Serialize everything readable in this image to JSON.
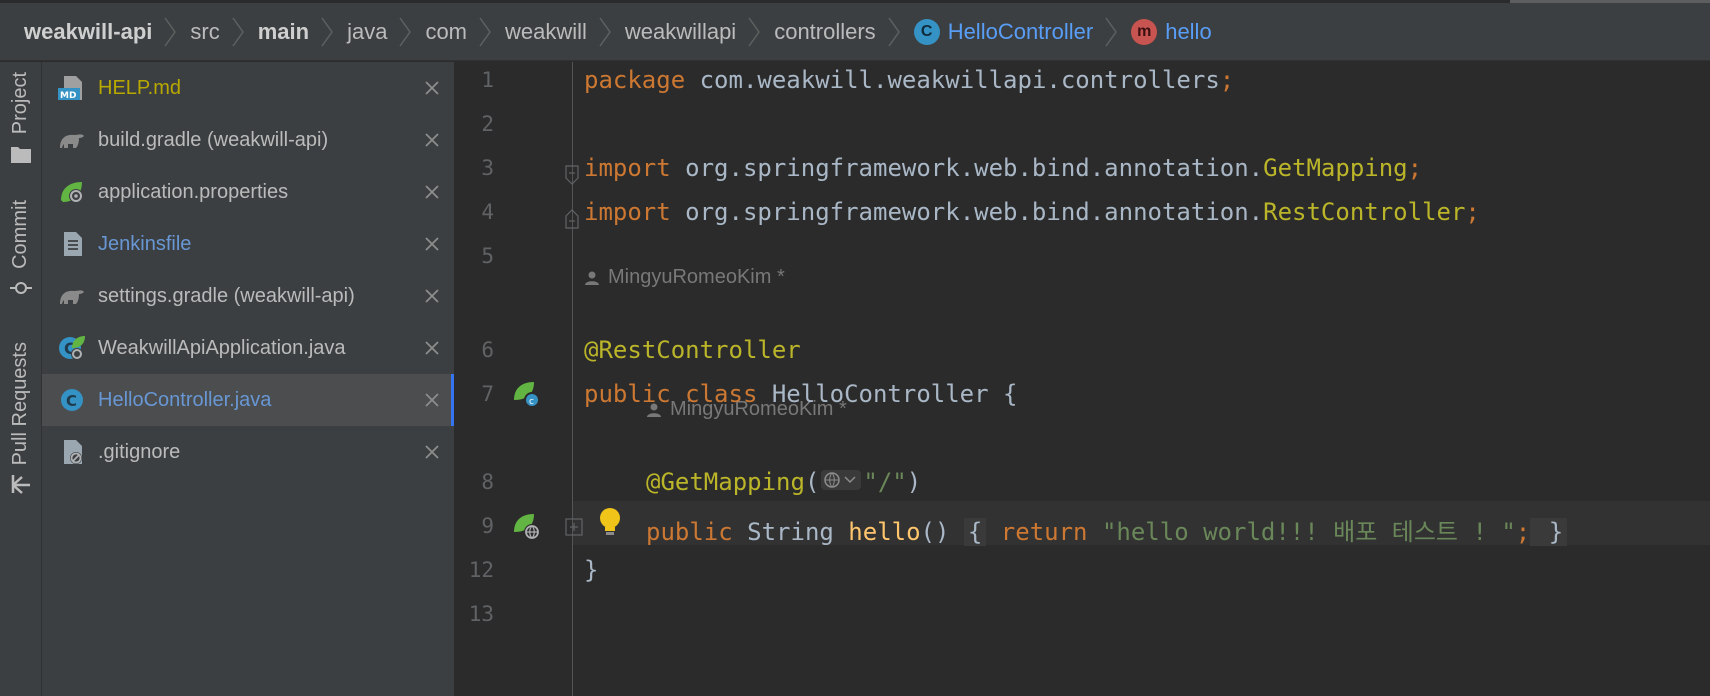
{
  "breadcrumb": [
    {
      "label": "weakwill-api"
    },
    {
      "label": "src"
    },
    {
      "label": "main"
    },
    {
      "label": "java"
    },
    {
      "label": "com"
    },
    {
      "label": "weakwill"
    },
    {
      "label": "weakwillapi"
    },
    {
      "label": "controllers"
    },
    {
      "label": "HelloController",
      "icon_letter": "C"
    },
    {
      "label": "hello",
      "icon_letter": "m"
    }
  ],
  "tool_stripe": {
    "project": "Project",
    "commit": "Commit",
    "pull_requests": "Pull Requests"
  },
  "open_files": [
    {
      "name": "HELP.md",
      "icon": "markdown-icon",
      "color": "#b8a900"
    },
    {
      "name": "build.gradle (weakwill-api)",
      "icon": "gradle-icon"
    },
    {
      "name": "application.properties",
      "icon": "spring-properties-icon"
    },
    {
      "name": "Jenkinsfile",
      "icon": "text-file-icon",
      "color": "#6897d4"
    },
    {
      "name": "settings.gradle (weakwill-api)",
      "icon": "gradle-icon"
    },
    {
      "name": "WeakwillApiApplication.java",
      "icon": "spring-boot-icon"
    },
    {
      "name": "HelloController.java",
      "icon": "java-class-icon",
      "color": "#6897d4",
      "selected": true
    },
    {
      "name": ".gitignore",
      "icon": "ignore-file-icon"
    }
  ],
  "editor": {
    "line_numbers": [
      "1",
      "2",
      "3",
      "4",
      "5",
      "6",
      "7",
      "8",
      "9",
      "12",
      "13"
    ],
    "author_hint_1": "MingyuRomeoKim *",
    "author_hint_2": "MingyuRomeoKim *",
    "lines": {
      "l1_kw": "package",
      "l1_rest": " com.weakwill.weakwillapi.controllers",
      "l1_semi": ";",
      "l3_kw": "import",
      "l3_rest": " org.springframework.web.bind.annotation.",
      "l3_cls": "GetMapping",
      "l3_semi": ";",
      "l4_kw": "import",
      "l4_rest": " org.springframework.web.bind.annotation.",
      "l4_cls": "RestController",
      "l4_semi": ";",
      "l6_ann": "@RestController",
      "l7_kw": "public class",
      "l7_rest": " HelloController {",
      "l8_ann": "@GetMapping",
      "l8_open": "(",
      "l8_str": "\"/\"",
      "l8_close": ")",
      "l9_kw": "public",
      "l9_type": " String ",
      "l9_fn": "hello",
      "l9_paren": "() ",
      "l9_fold_open": "{",
      "l9_ret": " return ",
      "l9_str": "\"hello world!!! 배포 테스트 ! \"",
      "l9_semi": ";",
      "l9_fold_close": " }",
      "l12": "}"
    }
  }
}
